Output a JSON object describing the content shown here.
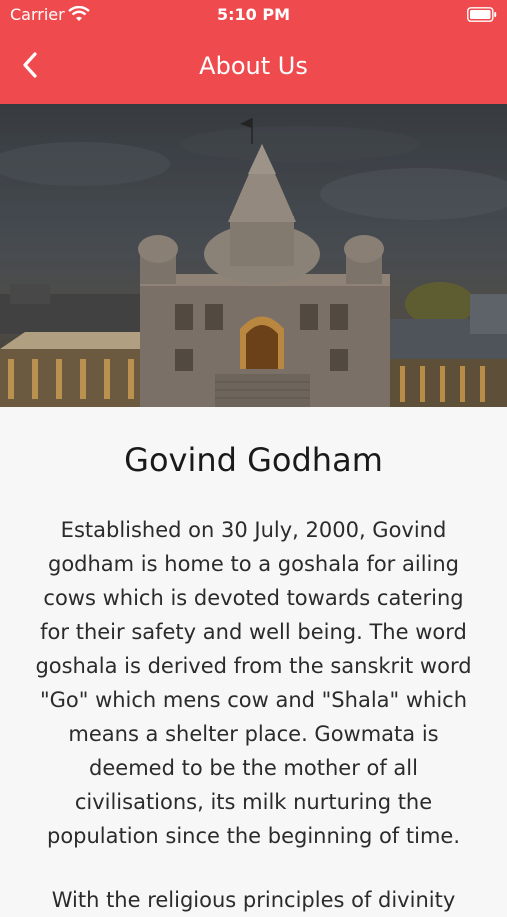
{
  "status_bar": {
    "carrier": "Carrier",
    "time": "5:10 PM"
  },
  "nav": {
    "title": "About Us",
    "back_icon": "chevron-left-icon"
  },
  "hero": {
    "image": "temple-photo"
  },
  "article": {
    "title": "Govind Godham",
    "paragraphs": [
      "Established on 30 July, 2000, Govind godham is home to a goshala for ailing cows which is devoted towards catering for their safety and well being. The word goshala is derived from the sanskrit word \"Go\" which mens cow and \"Shala\" which means a shelter place. Gowmata is deemed to be the mother of all civilisations, its milk nurturing the population since the beginning of time.",
      "With the religious principles of divinity"
    ]
  },
  "colors": {
    "header_bg": "#ef4b4f",
    "header_text": "#ffffff",
    "page_bg": "#f7f7f7",
    "body_text": "#2b2b2b"
  }
}
